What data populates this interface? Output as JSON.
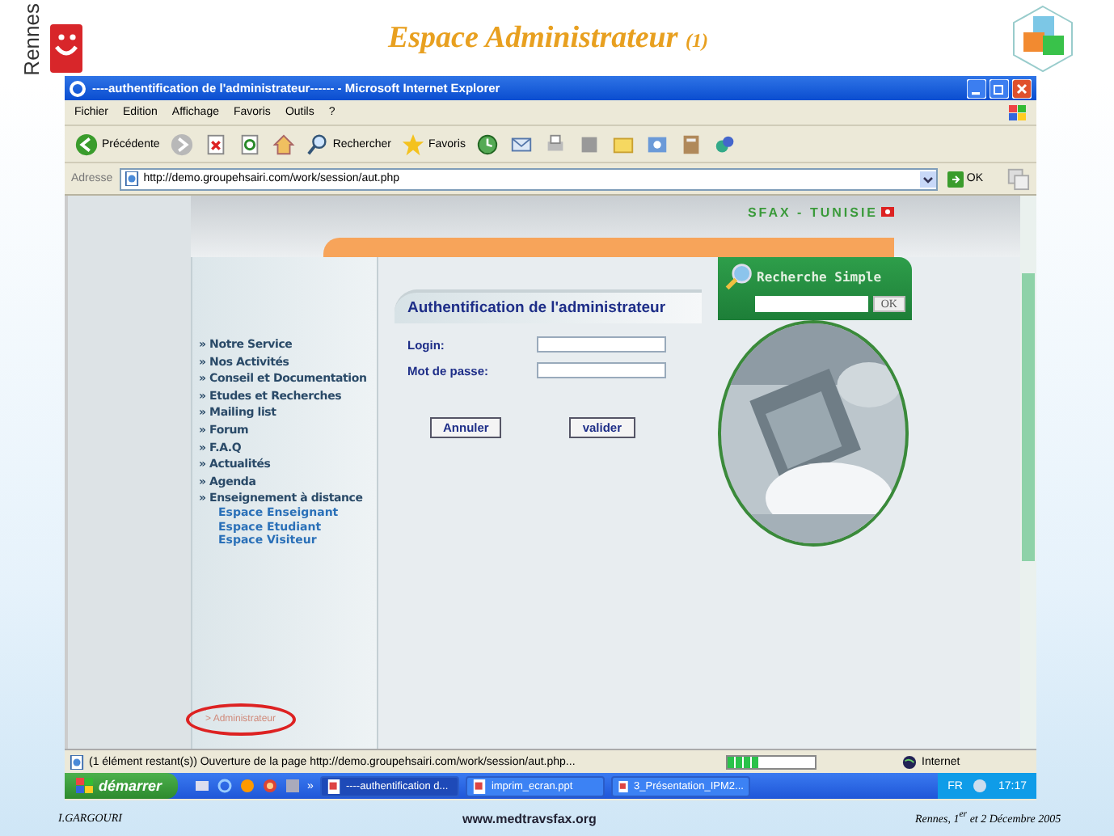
{
  "slide": {
    "title": "Espace Administrateur",
    "title_number": "(1)",
    "logo_text": "Rennes",
    "footer_author": "I.GARGOURI",
    "footer_site": "www.medtravsfax.org",
    "footer_date": "Rennes, 1$^{er}$ et 2  Décembre 2005"
  },
  "window": {
    "title": "----authentification de l'administrateur------ - Microsoft Internet Explorer"
  },
  "menu": [
    "Fichier",
    "Edition",
    "Affichage",
    "Favoris",
    "Outils",
    "?"
  ],
  "toolbar": [
    {
      "kind": "back",
      "label": "Précédente"
    },
    {
      "kind": "forward"
    },
    {
      "kind": "stop"
    },
    {
      "kind": "refresh"
    },
    {
      "kind": "home"
    },
    {
      "kind": "search",
      "label": "Rechercher"
    },
    {
      "kind": "favorites",
      "label": "Favoris"
    },
    {
      "kind": "history"
    },
    {
      "kind": "mail"
    },
    {
      "kind": "print"
    },
    {
      "kind": "edit"
    },
    {
      "kind": "folder"
    },
    {
      "kind": "messenger"
    },
    {
      "kind": "research"
    },
    {
      "kind": "tool"
    }
  ],
  "address": {
    "label": "Adresse",
    "value": "http://demo.groupehsairi.com/work/session/aut.php",
    "go": "OK"
  },
  "site": {
    "region": "SFAX - TUNISIE",
    "sidebar": [
      {
        "label": "» Notre Service"
      },
      {
        "label": "» Nos Activités"
      },
      {
        "label": "» Conseil et Documentation"
      },
      {
        "label": "» Etudes et Recherches"
      },
      {
        "label": "» Mailing list"
      },
      {
        "label": "» Forum"
      },
      {
        "label": "» F.A.Q"
      },
      {
        "label": "» Actualités"
      },
      {
        "label": "» Agenda"
      },
      {
        "label": "» Enseignement à distance",
        "children": [
          {
            "label": "Espace Enseignant"
          },
          {
            "label": "Espace Etudiant"
          },
          {
            "label": "Espace Visiteur"
          }
        ]
      }
    ],
    "admin_link": "> Administrateur",
    "login": {
      "title": "Authentification de l'administrateur",
      "fields": [
        {
          "label": "Login:"
        },
        {
          "label": "Mot de passe:"
        }
      ],
      "buttons": [
        "Annuler",
        "valider"
      ]
    },
    "search": {
      "title": "Recherche Simple",
      "button": "OK"
    }
  },
  "status_bar": {
    "text": "(1 élément restant(s)) Ouverture de la page http://demo.groupehsairi.com/work/session/aut.php...",
    "level": 0.35,
    "zone": "Internet"
  },
  "taskbar": {
    "start": "démarrer",
    "more": "»",
    "tasks": [
      {
        "label": "----authentification d...",
        "selected": true
      },
      {
        "label": "imprim_ecran.ppt",
        "selected": false
      },
      {
        "label": "3_Présentation_IPM2...",
        "selected": false
      }
    ],
    "lang": "FR",
    "time": "17:17"
  }
}
